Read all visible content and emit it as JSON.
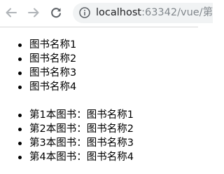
{
  "browser": {
    "url_host": "localhost",
    "url_rest": ":63342/vue/第",
    "icons": {
      "back": "arrow-left-icon",
      "forward": "arrow-right-icon",
      "reload": "reload-icon",
      "info": "info-icon"
    }
  },
  "books": [
    {
      "label": "图书名称1"
    },
    {
      "label": "图书名称2"
    },
    {
      "label": "图书名称3"
    },
    {
      "label": "图书名称4"
    }
  ],
  "indexed_books": [
    {
      "label": "第1本图书：图书名称1"
    },
    {
      "label": "第2本图书：图书名称2"
    },
    {
      "label": "第3本图书：图书名称3"
    },
    {
      "label": "第4本图书：图书名称4"
    }
  ]
}
